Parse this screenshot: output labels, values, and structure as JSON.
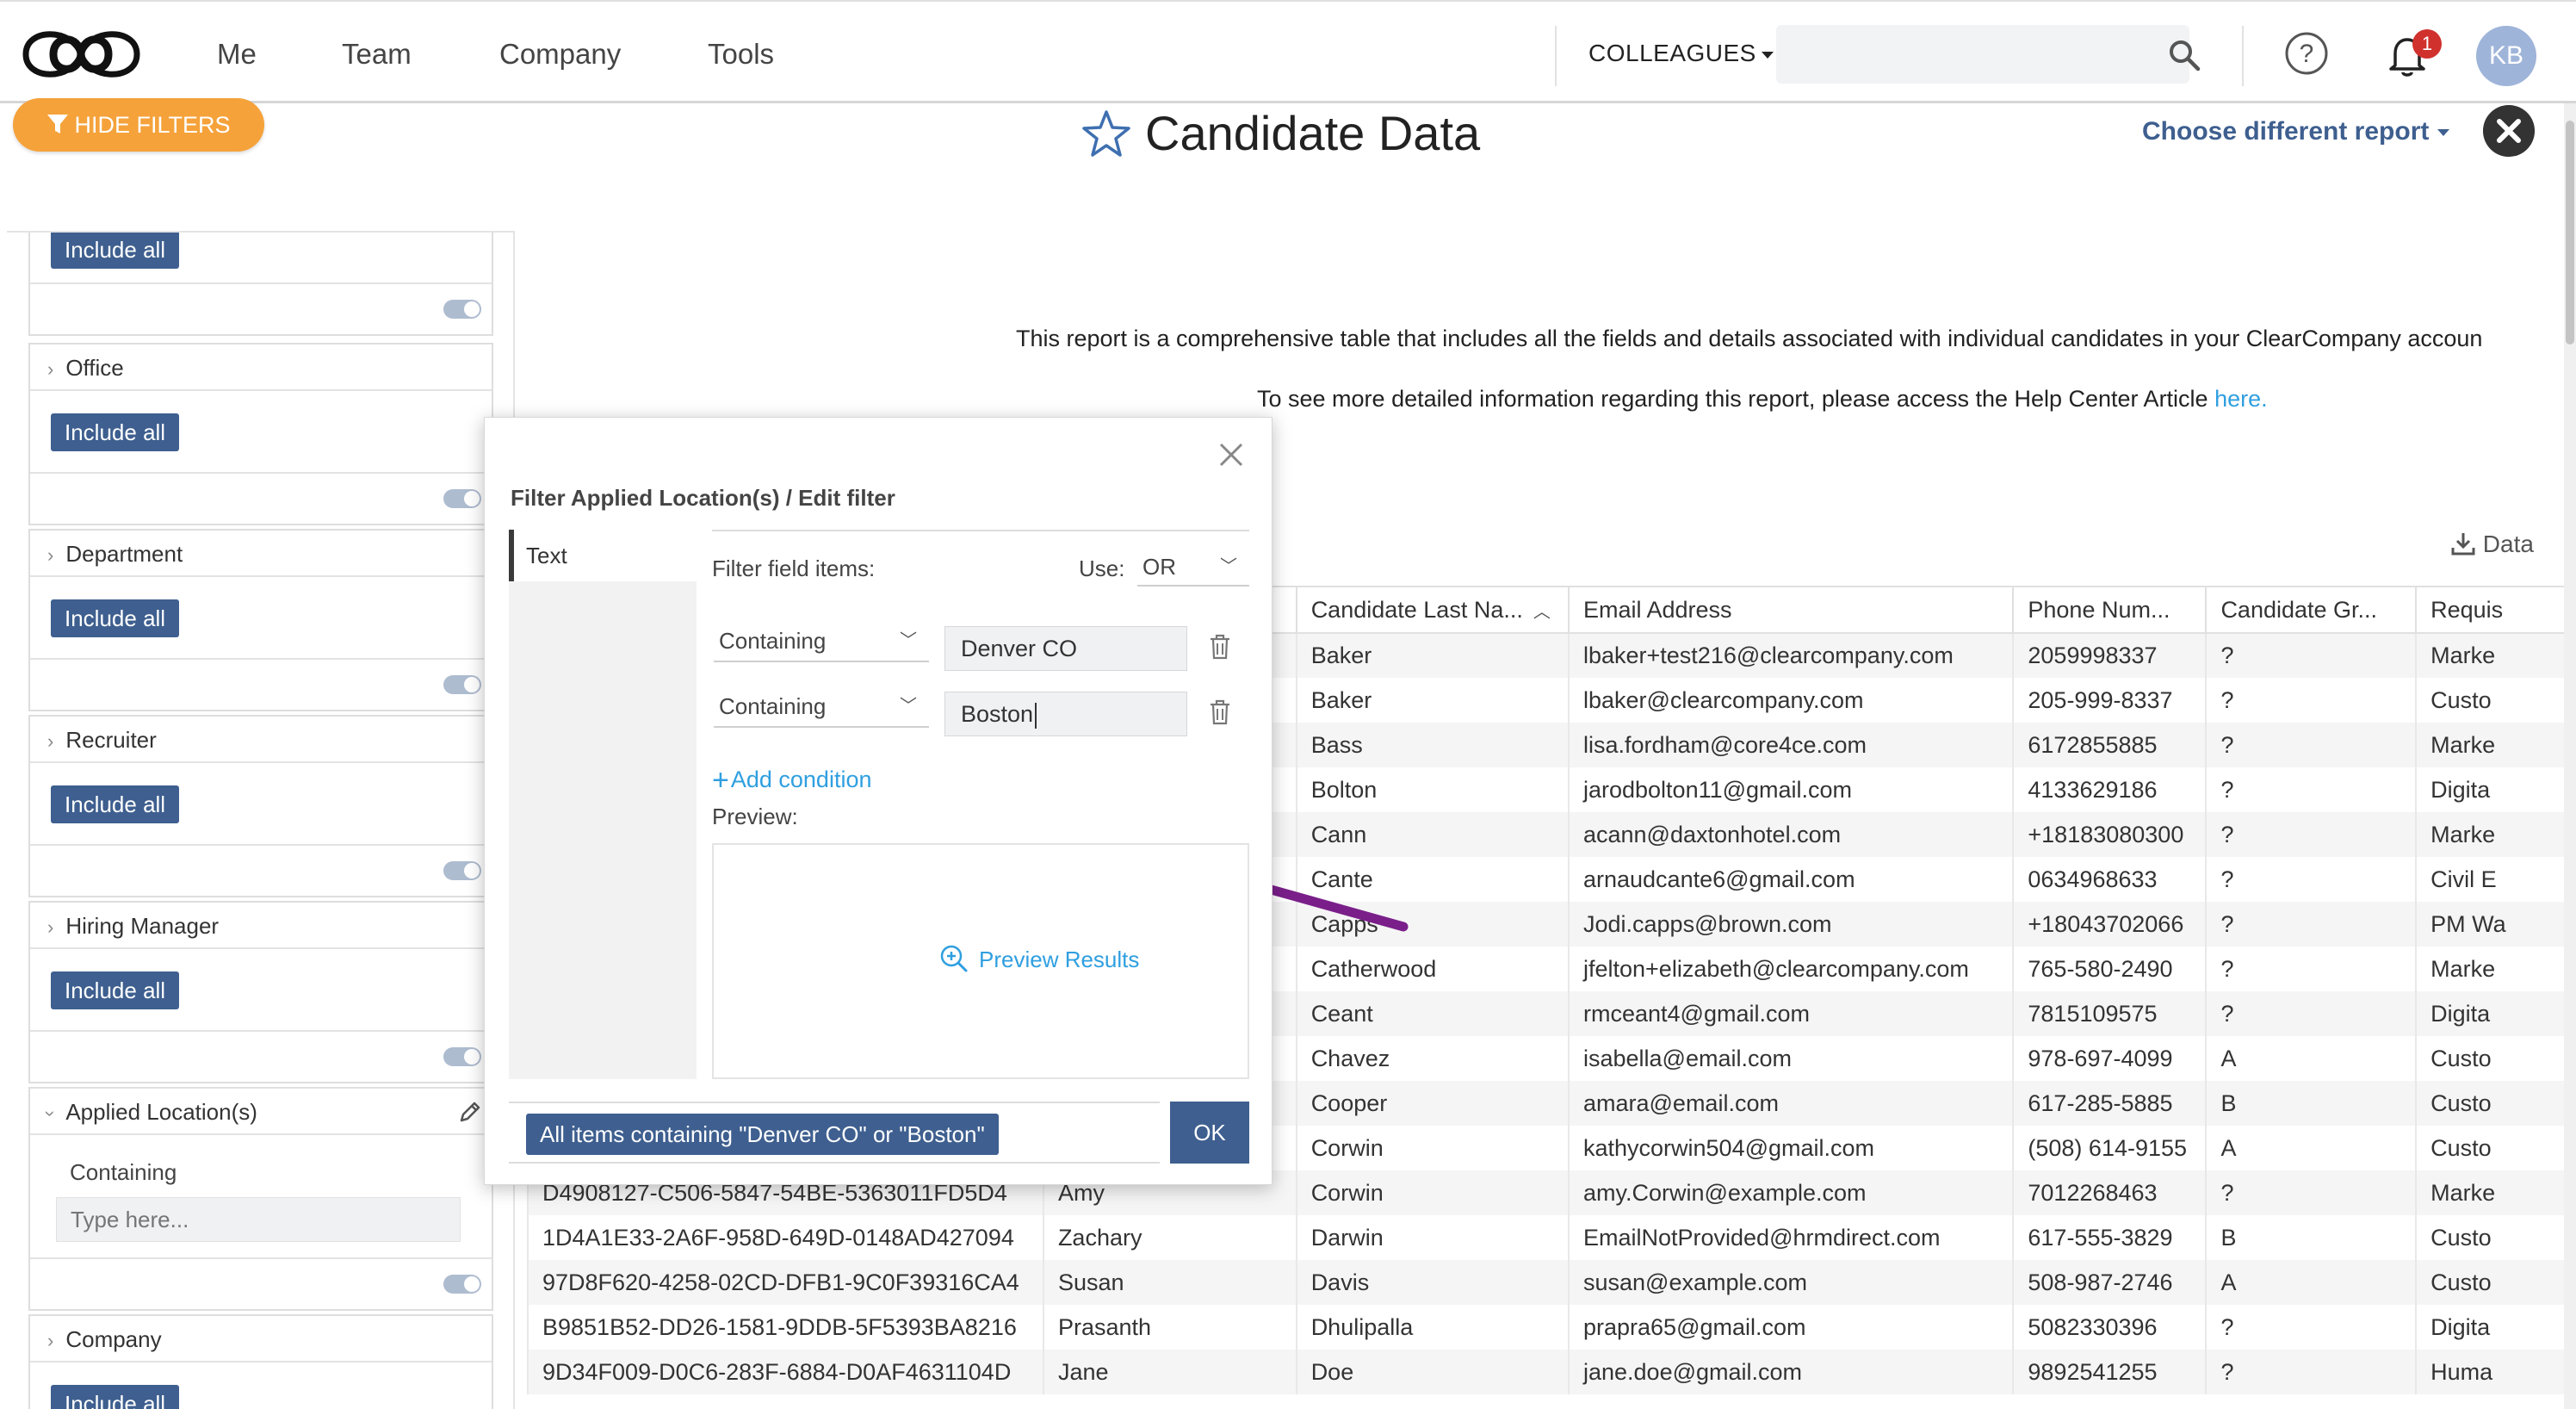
{
  "nav": {
    "links": [
      "Me",
      "Team",
      "Company",
      "Tools"
    ],
    "colleagues": "COLLEAGUES",
    "search_placeholder": "",
    "notification_count": "1",
    "avatar_initials": "KB"
  },
  "header": {
    "hide_filters": "HIDE FILTERS",
    "title": "Candidate Data",
    "choose_report": "Choose different report"
  },
  "sidebar": {
    "include_all": "Include all",
    "groups": [
      "Office",
      "Department",
      "Recruiter",
      "Hiring Manager",
      "Applied Location(s)",
      "Company"
    ],
    "applied_location": {
      "containing": "Containing",
      "placeholder": "Type here..."
    }
  },
  "info": {
    "line1": "This report is a comprehensive table that includes all the fields and details associated with individual candidates in your ClearCompany accoun",
    "line2_prefix": "To see more detailed information regarding this report, please access the Help Center Article ",
    "line2_link": "here."
  },
  "export_label": "Data",
  "table": {
    "headers": [
      "",
      "",
      "Candidate Last Na...",
      "Email Address",
      "Phone Num...",
      "Candidate Gr...",
      "Requis"
    ],
    "rows": [
      [
        "",
        "",
        "Baker",
        "lbaker+test216@clearcompany.com",
        "2059998337",
        "?",
        "Marke"
      ],
      [
        "",
        "",
        "Baker",
        "lbaker@clearcompany.com",
        "205-999-8337",
        "?",
        "Custo"
      ],
      [
        "",
        "",
        "Bass",
        "lisa.fordham@core4ce.com",
        "6172855885",
        "?",
        "Marke"
      ],
      [
        "",
        "",
        "Bolton",
        "jarodbolton11@gmail.com",
        "4133629186",
        "?",
        "Digita"
      ],
      [
        "",
        "",
        "Cann",
        "acann@daxtonhotel.com",
        "+18183080300",
        "?",
        "Marke"
      ],
      [
        "",
        "",
        "Cante",
        "arnaudcante6@gmail.com",
        "0634968633",
        "?",
        "Civil E"
      ],
      [
        "",
        "",
        "Capps",
        "Jodi.capps@brown.com",
        "+18043702066",
        "?",
        "PM Wa"
      ],
      [
        "",
        "",
        "Catherwood",
        "jfelton+elizabeth@clearcompany.com",
        "765-580-2490",
        "?",
        "Marke"
      ],
      [
        "",
        "",
        "Ceant",
        "rmceant4@gmail.com",
        "7815109575",
        "?",
        "Digita"
      ],
      [
        "",
        "",
        "Chavez",
        "isabella@email.com",
        "978-697-4099",
        "A",
        "Custo"
      ],
      [
        "",
        "",
        "Cooper",
        "amara@email.com",
        "617-285-5885",
        "B",
        "Custo"
      ],
      [
        "",
        "",
        "Corwin",
        "kathycorwin504@gmail.com",
        "(508) 614-9155",
        "A",
        "Custo"
      ],
      [
        "D4908127-C506-5847-54BE-5363011FD5D4",
        "Amy",
        "Corwin",
        "amy.Corwin@example.com",
        "7012268463",
        "?",
        "Marke"
      ],
      [
        "1D4A1E33-2A6F-958D-649D-0148AD427094",
        "Zachary",
        "Darwin",
        "EmailNotProvided@hrmdirect.com",
        "617-555-3829",
        "B",
        "Custo"
      ],
      [
        "97D8F620-4258-02CD-DFB1-9C0F39316CA4",
        "Susan",
        "Davis",
        "susan@example.com",
        "508-987-2746",
        "A",
        "Custo"
      ],
      [
        "B9851B52-DD26-1581-9DDB-5F5393BA8216",
        "Prasanth",
        "Dhulipalla",
        "prapra65@gmail.com",
        "5082330396",
        "?",
        "Digita"
      ],
      [
        "9D34F009-D0C6-283F-6884-D0AF4631104D",
        "Jane",
        "Doe",
        "jane.doe@gmail.com",
        "9892541255",
        "?",
        "Huma"
      ]
    ]
  },
  "modal": {
    "title": "Filter Applied Location(s) / Edit filter",
    "tab": "Text",
    "filter_field_items": "Filter field items:",
    "use_label": "Use:",
    "use_value": "OR",
    "conditions": [
      {
        "op": "Containing",
        "value": "Denver CO"
      },
      {
        "op": "Containing",
        "value": "Boston"
      }
    ],
    "add_condition": "Add condition",
    "preview_label": "Preview:",
    "preview_results": "Preview Results",
    "summary": "All items containing \"Denver CO\" or \"Boston\"",
    "ok": "OK"
  },
  "colors": {
    "accent_blue": "#3e5f8f",
    "orange": "#f5a23a",
    "link_blue": "#2f9fe0",
    "arrow_purple": "#7a1f8a"
  }
}
